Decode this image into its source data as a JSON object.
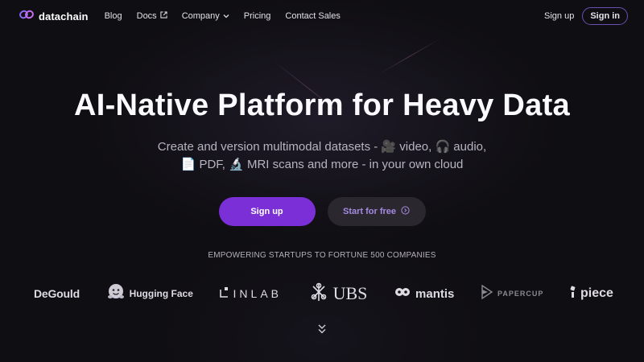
{
  "nav": {
    "logo_text": "datachain",
    "links": [
      {
        "label": "Blog"
      },
      {
        "label": "Docs"
      },
      {
        "label": "Company"
      },
      {
        "label": "Pricing"
      },
      {
        "label": "Contact Sales"
      }
    ],
    "sign_up": "Sign up",
    "sign_in": "Sign in"
  },
  "hero": {
    "title": "AI-Native Platform for Heavy Data",
    "subtitle_line1": "Create and version multimodal datasets - 🎥 video, 🎧 audio,",
    "subtitle_line2": "📄 PDF, 🔬 MRI scans and more - in your own cloud",
    "primary_cta": "Sign up",
    "secondary_cta": "Start for free"
  },
  "customers": {
    "heading": "EMPOWERING STARTUPS TO FORTUNE 500 COMPANIES",
    "logos": [
      "DeGould",
      "Hugging Face",
      "INLAB",
      "UBS",
      "mantis",
      "PAPERCUP",
      "piece"
    ]
  },
  "colors": {
    "background": "#0f0e12",
    "accent": "#7b2fd6",
    "secondary_button": "#2a272e",
    "sign_in_border": "#6b4fb0"
  },
  "icons": {
    "logo": "datachain-link-icon",
    "docs": "external-link-icon",
    "company": "chevron-down-icon",
    "secondary_cta": "arrow-circle-right-icon",
    "scroll": "double-chevron-down-icon"
  }
}
